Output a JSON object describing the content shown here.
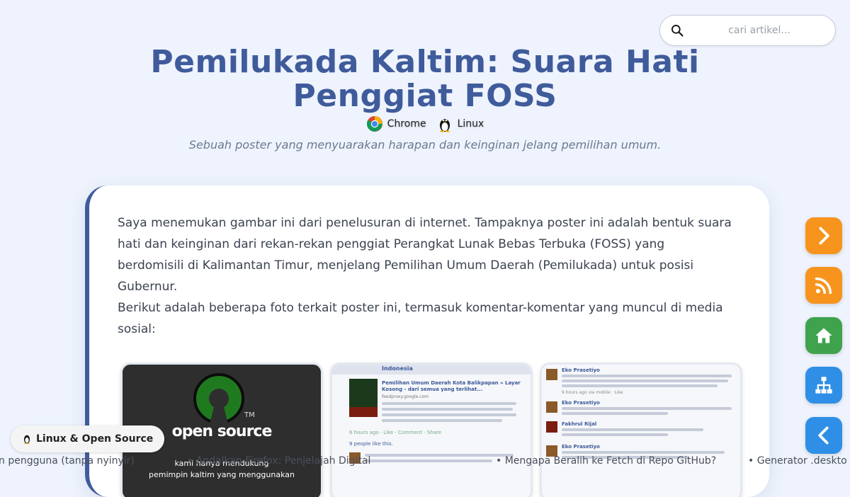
{
  "search": {
    "placeholder": "cari artikel..."
  },
  "post": {
    "title": "Pemilukada Kaltim: Suara Hati Penggiat FOSS",
    "tags": [
      {
        "label": "Chrome",
        "icon": "chrome-icon"
      },
      {
        "label": "Linux",
        "icon": "tux-icon"
      }
    ],
    "subtitle": "Sebuah poster yang menyuarakan harapan dan keinginan jelang pemilihan umum.",
    "paragraph_1": "Saya menemukan gambar ini dari penelusuran di internet. Tampaknya poster ini adalah bentuk suara hati dan keinginan dari rekan-rekan penggiat Perangkat Lunak Bebas Terbuka (FOSS) yang berdomisili di Kalimantan Timur, menjelang Pemilihan Umum Daerah (Pemilukada) untuk posisi Gubernur.",
    "paragraph_2": "Berikut adalah beberapa foto terkait poster ini, termasuk komentar-komentar yang muncul di media sosial:"
  },
  "thumbnails": {
    "t1": {
      "brand": "open source",
      "tm": "TM",
      "caption_1": "kami hanya mendukung",
      "caption_2": "pemimpin kaltim yang menggunakan"
    },
    "t2": {
      "header": "Indonesia",
      "link_title": "Pemilihan Umum Daerah Kota Balikpapan » Layar Kosong - dari semua yang terlihat...",
      "source": "feedproxy.google.com",
      "meta": "6 hours ago · Like · Comment · Share",
      "likes": "9 people like this."
    },
    "t3": {
      "name_1": "Eko Prasetiyo",
      "name_2": "Fakhrul Rijal",
      "meta": "9 hours ago via mobile · Like"
    }
  },
  "sidebar_buttons": [
    {
      "name": "next-button",
      "icon": "chevron-right-icon",
      "color": "#f7941d"
    },
    {
      "name": "rss-button",
      "icon": "rss-icon",
      "color": "#f7941d"
    },
    {
      "name": "home-button",
      "icon": "home-icon",
      "color": "#3fa34d"
    },
    {
      "name": "sitemap-button",
      "icon": "sitemap-icon",
      "color": "#2f8fe6"
    },
    {
      "name": "prev-button",
      "icon": "chevron-left-icon",
      "color": "#2f8fe6"
    }
  ],
  "category_badge": {
    "label": "Linux & Open Source",
    "icon": "penguin-icon"
  },
  "ticker": {
    "items": [
      "n pengguna (tanpa nyinyir)",
      "• Andalkan Firefox: Penjelajah Digital",
      "• Mengapa Beralih ke Fetch di Repo GitHub?",
      "• Generator .deskto"
    ]
  }
}
